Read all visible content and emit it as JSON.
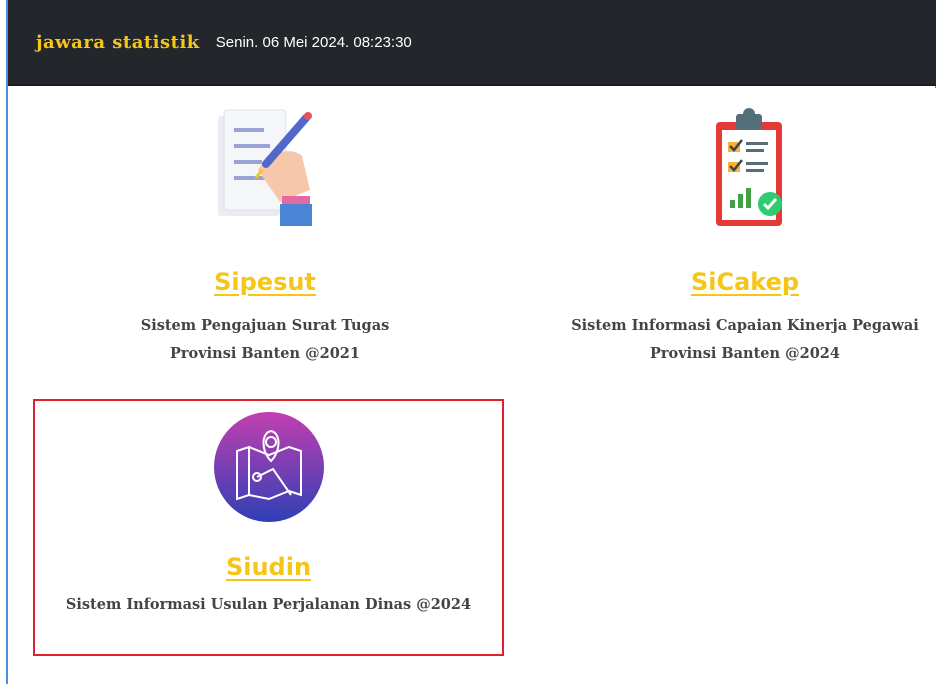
{
  "header": {
    "brand": "jawara statistik",
    "datetime": "Senin. 06 Mei 2024. 08:23:30"
  },
  "apps": [
    {
      "name": "Sipesut",
      "desc_line1": "Sistem Pengajuan Surat Tugas",
      "desc_line2": "Provinsi Banten @2021",
      "icon": "hand-writing-document-icon"
    },
    {
      "name": "SiCakep",
      "desc_line1": "Sistem Informasi Capaian Kinerja Pegawai",
      "desc_line2": "Provinsi Banten @2024",
      "icon": "clipboard-checklist-icon"
    },
    {
      "name": "Siudin",
      "desc_line1": "Sistem Informasi Usulan Perjalanan Dinas @2024",
      "icon": "map-location-icon",
      "highlighted": true
    }
  ],
  "colors": {
    "navbar_bg": "#23272b",
    "brand": "#f5c518",
    "title_link": "#f5c518",
    "highlight_border": "#e0202a",
    "desc_text": "#444444"
  }
}
